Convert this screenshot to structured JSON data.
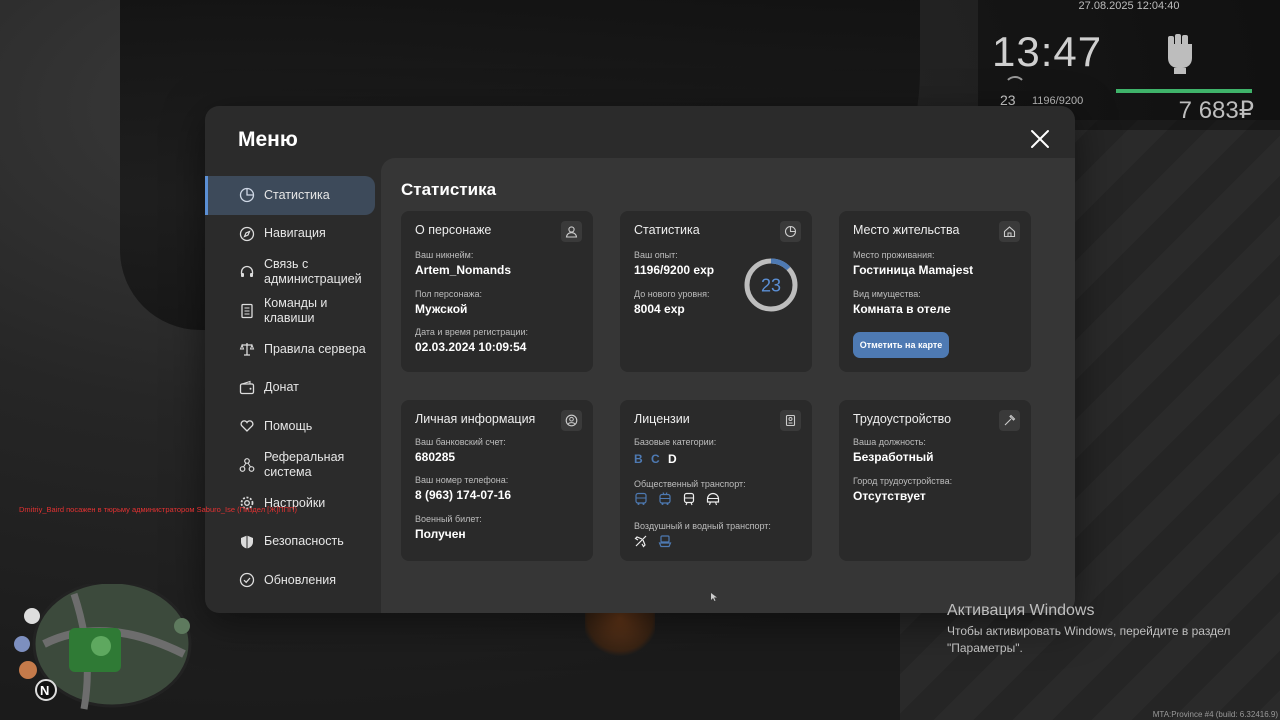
{
  "hud": {
    "datetime": "27.08.2025 12:04:40",
    "time": "13:47",
    "level": "23",
    "exp": "1196/9200",
    "money": "7 683₽",
    "fist_icon": "fist-icon"
  },
  "menu": {
    "title": "Меню",
    "nav": [
      {
        "label": "Статистика",
        "icon": "pie-chart-icon"
      },
      {
        "label": "Навигация",
        "icon": "compass-icon"
      },
      {
        "label": "Связь с администрацией",
        "icon": "headset-icon"
      },
      {
        "label": "Команды и клавиши",
        "icon": "document-icon"
      },
      {
        "label": "Правила сервера",
        "icon": "scales-icon"
      },
      {
        "label": "Донат",
        "icon": "wallet-icon"
      },
      {
        "label": "Помощь",
        "icon": "heart-hand-icon"
      },
      {
        "label": "Реферальная система",
        "icon": "network-icon"
      },
      {
        "label": "Настройки",
        "icon": "gear-icon"
      },
      {
        "label": "Безопасность",
        "icon": "shield-icon"
      },
      {
        "label": "Обновления",
        "icon": "check-circle-icon"
      }
    ]
  },
  "content": {
    "title": "Статистика",
    "character": {
      "title": "О персонаже",
      "nick_label": "Ваш никнейм:",
      "nick": "Artem_Nomands",
      "gender_label": "Пол персонажа:",
      "gender": "Мужской",
      "reg_label": "Дата и время регистрации:",
      "reg": "02.03.2024 10:09:54"
    },
    "stats": {
      "title": "Статистика",
      "exp_label": "Ваш опыт:",
      "exp": "1196/9200 exp",
      "next_label": "До нового уровня:",
      "next": "8004 exp",
      "level": "23",
      "progress": 0.13
    },
    "residence": {
      "title": "Место жительства",
      "place_label": "Место проживания:",
      "place": "Гостиница Mamajest",
      "property_label": "Вид имущества:",
      "property": "Комната в отеле",
      "button": "Отметить на карте"
    },
    "personal": {
      "title": "Личная информация",
      "bank_label": "Ваш банковский счет:",
      "bank": "680285",
      "phone_label": "Ваш номер телефона:",
      "phone": "8 (963) 174-07-16",
      "military_label": "Военный билет:",
      "military": "Получен"
    },
    "licenses": {
      "title": "Лицензии",
      "base_label": "Базовые категории:",
      "cats": [
        "B",
        "C",
        "D"
      ],
      "public_label": "Общественный транспорт:",
      "air_label": "Воздушный и водный транспорт:"
    },
    "job": {
      "title": "Трудоустройство",
      "position_label": "Ваша должность:",
      "position": "Безработный",
      "city_label": "Город трудоустройства:",
      "city": "Отсутствует"
    }
  },
  "overlay": {
    "chat": "Dmitriy_Baird посажен в тюрьму администратором Saburo_Ise (Пиздел [Ж]ППП)",
    "win_title": "Активация Windows",
    "win_text": "Чтобы активировать Windows, перейдите в раздел \"Параметры\".",
    "build": "MTA:Province #4 (build: 6.32416.9)"
  },
  "colors": {
    "accent": "#5b8fd4",
    "button": "#4e7ab3",
    "money_bar": "#3fb36a"
  }
}
